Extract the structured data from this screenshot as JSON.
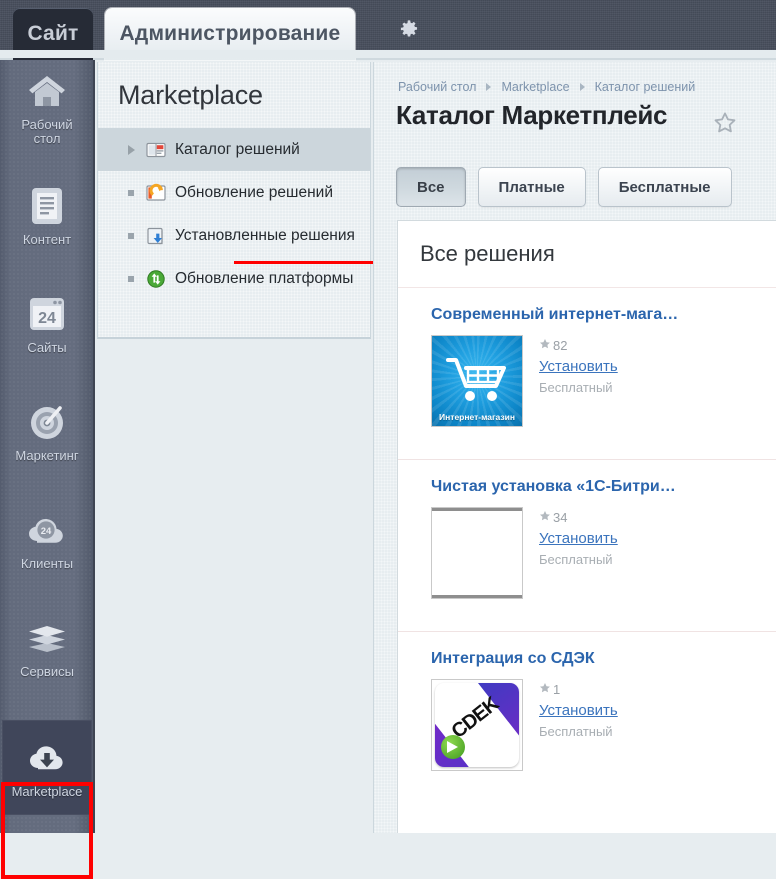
{
  "topbar": {
    "tabs": [
      {
        "label": "Сайт",
        "active": false
      },
      {
        "label": "Администрирование",
        "active": true
      }
    ],
    "gear_icon": "gear-icon"
  },
  "rail": {
    "items": [
      {
        "label": "Рабочий\nстол",
        "label_line1": "Рабочий",
        "label_line2": "стол",
        "icon": "home-icon"
      },
      {
        "label": "Контент",
        "icon": "document-icon"
      },
      {
        "label": "Сайты",
        "icon": "window-24-icon"
      },
      {
        "label": "Маркетинг",
        "icon": "target-icon"
      },
      {
        "label": "Клиенты",
        "icon": "cloud-24-icon"
      },
      {
        "label": "Сервисы",
        "icon": "layers-icon"
      },
      {
        "label": "Marketplace",
        "icon": "cloud-download-icon"
      }
    ],
    "active_label": "Marketplace",
    "highlight_color": "#ff0000"
  },
  "menu": {
    "title": "Marketplace",
    "items": [
      {
        "label": "Каталог решений",
        "icon": "catalog-icon",
        "marker": "arrow",
        "active": true
      },
      {
        "label": "Обновление решений",
        "icon": "update-solutions-icon",
        "marker": "dot",
        "active": false,
        "underlined": true
      },
      {
        "label": "Установленные решения",
        "icon": "installed-solutions-icon",
        "marker": "dot",
        "active": false
      },
      {
        "label": "Обновление платформы",
        "icon": "update-platform-icon",
        "marker": "dot",
        "active": false
      }
    ],
    "underline_color": "#ff0000"
  },
  "main": {
    "breadcrumb": [
      "Рабочий стол",
      "Marketplace",
      "Каталог решений"
    ],
    "page_title": "Каталог Маркетплейс",
    "favorite_icon": "star-outline-icon",
    "filter_tabs": [
      {
        "label": "Все",
        "active": true
      },
      {
        "label": "Платные",
        "active": false
      },
      {
        "label": "Бесплатные",
        "active": false
      }
    ],
    "content_heading": "Все решения",
    "solutions": [
      {
        "name": "Современный интернет-мага…",
        "rating": "82",
        "install_label": "Установить",
        "price_label": "Бесплатный",
        "thumb": "shop",
        "thumb_caption": "Интернет-магазин"
      },
      {
        "name": "Чистая установка «1С-Битри…",
        "rating": "34",
        "install_label": "Установить",
        "price_label": "Бесплатный",
        "thumb": "blank",
        "thumb_caption": ""
      },
      {
        "name": "Интеграция со СДЭК",
        "rating": "1",
        "install_label": "Установить",
        "price_label": "Бесплатный",
        "thumb": "cdek",
        "thumb_caption": "CDEK"
      }
    ]
  },
  "colors": {
    "topbar_bg": "#474e5c",
    "rail_bg": "#5e6678",
    "panel_bg": "#e7edf0",
    "link_blue": "#2b65ad",
    "accent_red": "#ff0000"
  }
}
